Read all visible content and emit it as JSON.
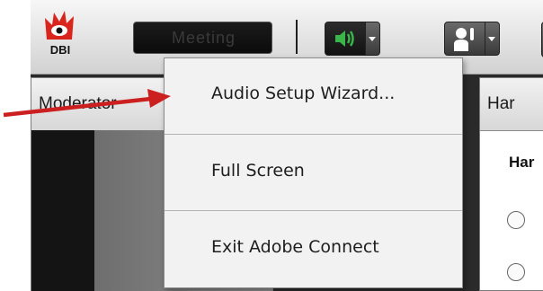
{
  "logo": {
    "text": "DBI",
    "brand_color": "#d9251c"
  },
  "toolbar": {
    "room_name": "Meeting",
    "audio_button": {
      "icon": "speaker-icon",
      "color": "#39b54a",
      "dropdown_icon": "chevron-down-icon"
    },
    "status_button": {
      "icon": "raise-hand-icon",
      "dropdown_icon": "chevron-down-icon"
    }
  },
  "pods": {
    "left_title": "Moderator",
    "right_title": "Har",
    "right_question": "Har"
  },
  "audio_menu": {
    "items": [
      {
        "label": "Audio Setup Wizard..."
      },
      {
        "label": "Full Screen"
      },
      {
        "label": "Exit Adobe Connect"
      }
    ]
  },
  "annotation": {
    "arrow_color": "#cc1f1f"
  }
}
